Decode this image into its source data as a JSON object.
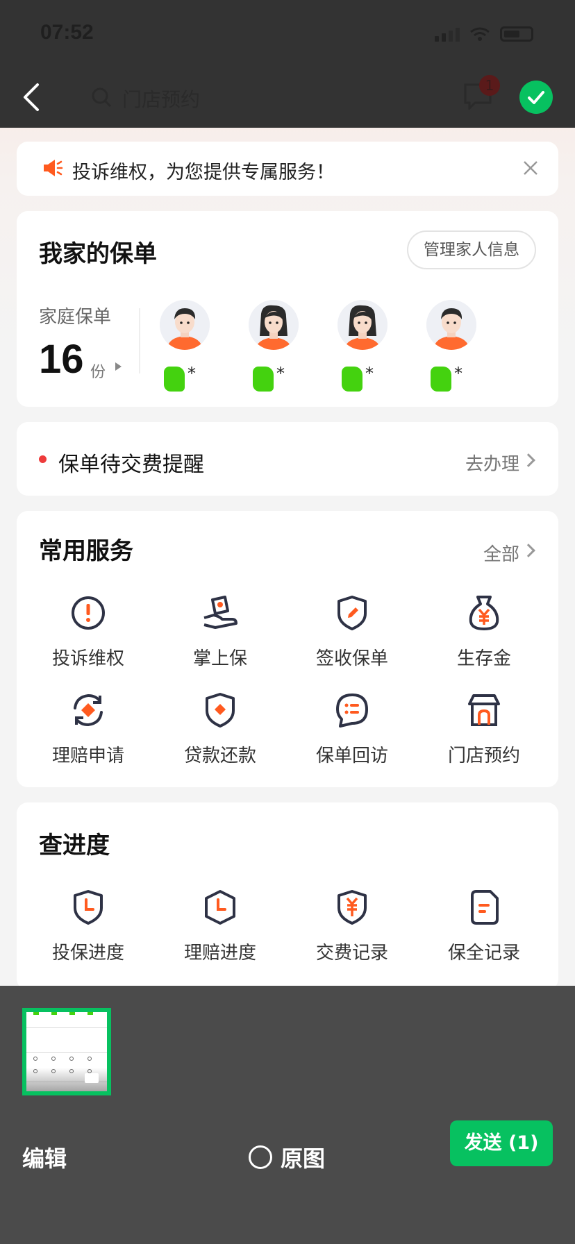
{
  "status_bar": {
    "time": "07:52"
  },
  "nav": {
    "search_placeholder": "门店预约",
    "message_badge": "1"
  },
  "notice": {
    "text": "投诉维权，为您提供专属服务！"
  },
  "family_policy": {
    "title": "我家的保单",
    "manage_label": "管理家人信息",
    "family_label": "家庭保单",
    "count": "16",
    "unit": "份",
    "members": [
      {
        "name_suffix": "*",
        "gender": "male"
      },
      {
        "name_suffix": "*",
        "gender": "female"
      },
      {
        "name_suffix": "*",
        "gender": "female"
      },
      {
        "name_suffix": "*",
        "gender": "male"
      }
    ]
  },
  "reminder": {
    "text": "保单待交费提醒",
    "action": "去办理"
  },
  "services": {
    "title": "常用服务",
    "all_label": "全部",
    "items": [
      {
        "label": "投诉维权",
        "icon": "alert-circle-icon"
      },
      {
        "label": "掌上保",
        "icon": "hand-shield-icon"
      },
      {
        "label": "签收保单",
        "icon": "shield-pen-icon"
      },
      {
        "label": "生存金",
        "icon": "money-bag-icon"
      },
      {
        "label": "理赔申请",
        "icon": "refresh-diamond-icon"
      },
      {
        "label": "贷款还款",
        "icon": "shield-diamond-icon"
      },
      {
        "label": "保单回访",
        "icon": "chat-list-icon"
      },
      {
        "label": "门店预约",
        "icon": "store-icon"
      }
    ]
  },
  "progress": {
    "title": "查进度",
    "items": [
      {
        "label": "投保进度",
        "icon": "shield-clock-icon"
      },
      {
        "label": "理赔进度",
        "icon": "pentagon-clock-icon"
      },
      {
        "label": "交费记录",
        "icon": "shield-yen-icon"
      },
      {
        "label": "保全记录",
        "icon": "document-icon"
      }
    ]
  },
  "bottom_bar": {
    "edit_label": "编辑",
    "original_label": "原图",
    "send_label": "发送 (1)"
  },
  "colors": {
    "accent": "#ff5a1f",
    "send_green": "#07c160",
    "icon_dark": "#2e3245"
  }
}
